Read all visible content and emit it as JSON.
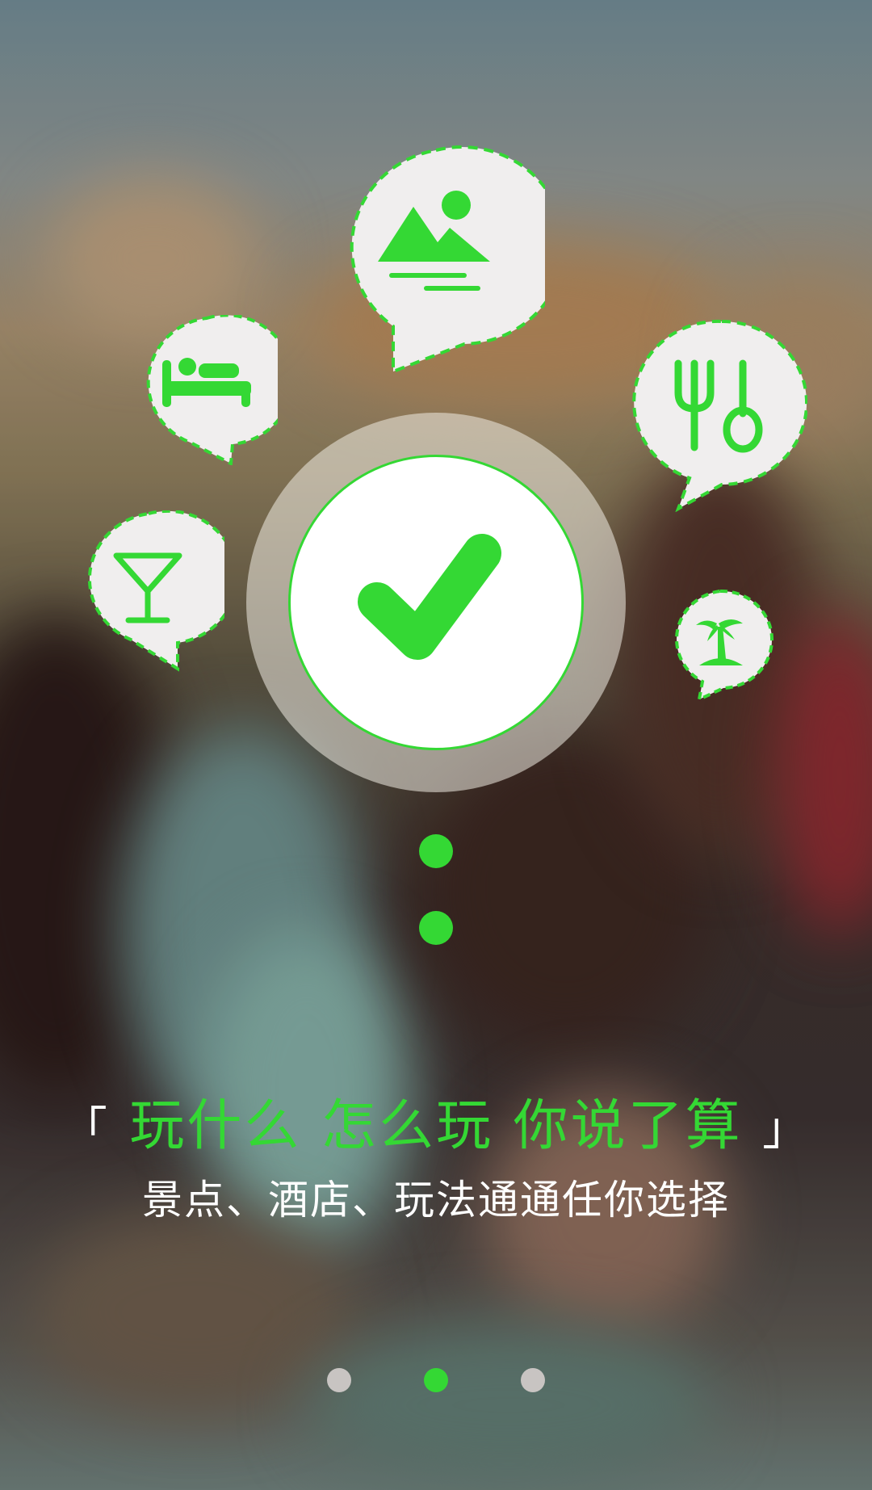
{
  "theme": {
    "accent": "#34d834",
    "bubble_fill": "#f0eeee",
    "text_white": "#ffffff",
    "pager_inactive": "#c8c4c2"
  },
  "icons": {
    "scenery": "landscape-icon",
    "hotel": "bed-icon",
    "dining": "fork-spoon-icon",
    "bar": "cocktail-icon",
    "beach": "palm-island-icon",
    "confirm": "checkmark-icon"
  },
  "headline": {
    "open_bracket": "「",
    "text": "玩什么 怎么玩 你说了算",
    "close_bracket": "」"
  },
  "subtitle": "景点、酒店、玩法通通任你选择",
  "pager": {
    "total": 3,
    "active_index": 1
  }
}
